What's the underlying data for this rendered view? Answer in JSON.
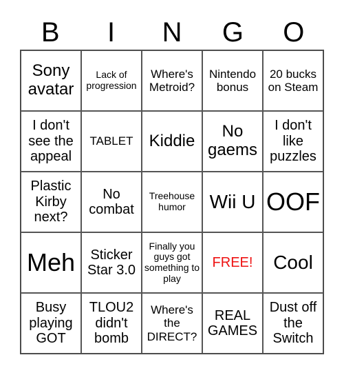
{
  "header": {
    "letters": [
      "B",
      "I",
      "N",
      "G",
      "O"
    ]
  },
  "card": {
    "free_color": "#ee1111",
    "cells": [
      {
        "text": "Sony avatar",
        "size": "s-lg"
      },
      {
        "text": "Lack of progression",
        "size": "s-xs"
      },
      {
        "text": "Where's Metroid?",
        "size": "s-sm"
      },
      {
        "text": "Nintendo bonus",
        "size": "s-sm"
      },
      {
        "text": "20 bucks on Steam",
        "size": "s-sm"
      },
      {
        "text": "I don't see the appeal",
        "size": "s-md"
      },
      {
        "text": "TABLET",
        "size": "s-sm"
      },
      {
        "text": "Kiddie",
        "size": "s-lg"
      },
      {
        "text": "No gaems",
        "size": "s-lg"
      },
      {
        "text": "I don't like puzzles",
        "size": "s-md"
      },
      {
        "text": "Plastic Kirby next?",
        "size": "s-md"
      },
      {
        "text": "No combat",
        "size": "s-md"
      },
      {
        "text": "Treehouse humor",
        "size": "s-xs"
      },
      {
        "text": "Wii U",
        "size": "s-xl"
      },
      {
        "text": "OOF",
        "size": "s-xxl"
      },
      {
        "text": "Meh",
        "size": "s-xxl"
      },
      {
        "text": "Sticker Star 3.0",
        "size": "s-md"
      },
      {
        "text": "Finally you guys got something to play",
        "size": "s-xs"
      },
      {
        "text": "FREE!",
        "size": "s-md",
        "free": true
      },
      {
        "text": "Cool",
        "size": "s-xl"
      },
      {
        "text": "Busy playing GOT",
        "size": "s-md"
      },
      {
        "text": "TLOU2 didn't bomb",
        "size": "s-md"
      },
      {
        "text": "Where's the DIRECT?",
        "size": "s-sm"
      },
      {
        "text": "REAL GAMES",
        "size": "s-md"
      },
      {
        "text": "Dust off the Switch",
        "size": "s-md"
      }
    ]
  }
}
